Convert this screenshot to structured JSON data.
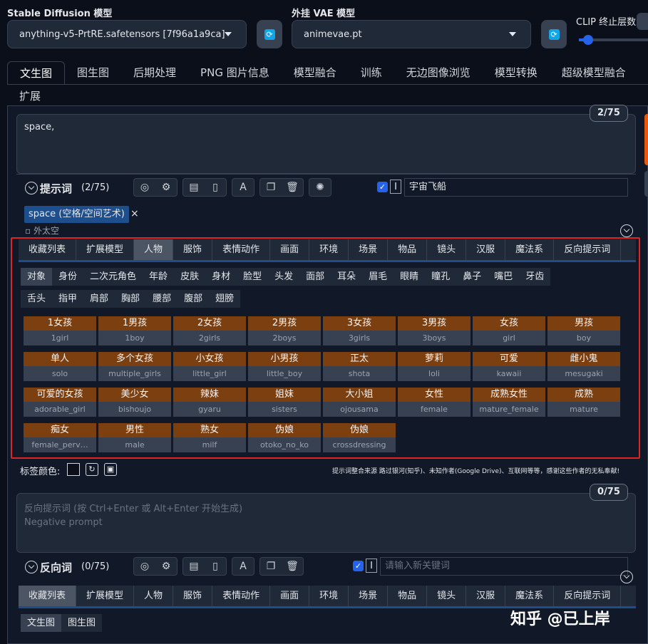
{
  "model": {
    "sd_label": "Stable Diffusion 模型",
    "sd_value": "anything-v5-PrtRE.safetensors [7f96a1a9ca]",
    "vae_label": "外挂 VAE 模型",
    "vae_value": "animevae.pt",
    "clip_label": "CLIP 终止层数"
  },
  "tabs": [
    "文生图",
    "图生图",
    "后期处理",
    "PNG 图片信息",
    "模型融合",
    "训练",
    "无边图像浏览",
    "模型转换",
    "超级模型融合"
  ],
  "tab_extra": "扩展",
  "prompt": {
    "text": "space,",
    "counter": "2/75",
    "title": "提示词",
    "count": "(2/75)",
    "keyword_value": "宇宙飞船",
    "chip_label": "space (空格/空间艺术)",
    "chip_close": "×",
    "chip_sub": "外太空"
  },
  "categories": [
    "收藏列表",
    "扩展模型",
    "人物",
    "服饰",
    "表情动作",
    "画面",
    "环境",
    "场景",
    "物品",
    "镜头",
    "汉服",
    "魔法系",
    "反向提示词"
  ],
  "subcategories_row1": [
    "对象",
    "身份",
    "二次元角色",
    "年龄",
    "皮肤",
    "身材",
    "脸型",
    "头发",
    "面部",
    "耳朵",
    "眉毛",
    "眼睛",
    "瞳孔",
    "鼻子",
    "嘴巴",
    "牙齿"
  ],
  "subcategories_row2": [
    "舌头",
    "指甲",
    "肩部",
    "胸部",
    "腰部",
    "腹部",
    "翅膀"
  ],
  "tags": [
    {
      "zh": "1女孩",
      "en": "1girl"
    },
    {
      "zh": "1男孩",
      "en": "1boy"
    },
    {
      "zh": "2女孩",
      "en": "2girls"
    },
    {
      "zh": "2男孩",
      "en": "2boys"
    },
    {
      "zh": "3女孩",
      "en": "3girls"
    },
    {
      "zh": "3男孩",
      "en": "3boys"
    },
    {
      "zh": "女孩",
      "en": "girl"
    },
    {
      "zh": "男孩",
      "en": "boy"
    },
    {
      "zh": "单人",
      "en": "solo"
    },
    {
      "zh": "多个女孩",
      "en": "multiple_girls"
    },
    {
      "zh": "小女孩",
      "en": "little_girl"
    },
    {
      "zh": "小男孩",
      "en": "little_boy"
    },
    {
      "zh": "正太",
      "en": "shota"
    },
    {
      "zh": "萝莉",
      "en": "loli"
    },
    {
      "zh": "可爱",
      "en": "kawaii"
    },
    {
      "zh": "雌小鬼",
      "en": "mesugaki"
    },
    {
      "zh": "可爱的女孩",
      "en": "adorable_girl"
    },
    {
      "zh": "美少女",
      "en": "bishoujo"
    },
    {
      "zh": "辣妹",
      "en": "gyaru"
    },
    {
      "zh": "姐妹",
      "en": "sisters"
    },
    {
      "zh": "大小姐",
      "en": "ojousama"
    },
    {
      "zh": "女性",
      "en": "female"
    },
    {
      "zh": "成熟女性",
      "en": "mature_female"
    },
    {
      "zh": "成熟",
      "en": "mature"
    },
    {
      "zh": "痴女",
      "en": "female_perv…"
    },
    {
      "zh": "男性",
      "en": "male"
    },
    {
      "zh": "熟女",
      "en": "milf"
    },
    {
      "zh": "伪娘",
      "en": "otoko_no_ko"
    },
    {
      "zh": "伪娘",
      "en": "crossdressing"
    }
  ],
  "tag_color_label": "标签颜色:",
  "credit_text": "提示词整合来源 路过银河(知乎)、未知作者(Google Drive)、互联网等等，感谢这些作者的无私奉献!",
  "negative": {
    "placeholder_line1": "反向提示词 (按 Ctrl+Enter 或 Alt+Enter 开始生成)",
    "placeholder_line2": "Negative prompt",
    "counter": "0/75",
    "title": "反向词",
    "count": "(0/75)",
    "keyword_placeholder": "请输入新关键词"
  },
  "bottom_subtabs": [
    "文生图",
    "图生图"
  ],
  "watermark": "知乎 @已上岸"
}
